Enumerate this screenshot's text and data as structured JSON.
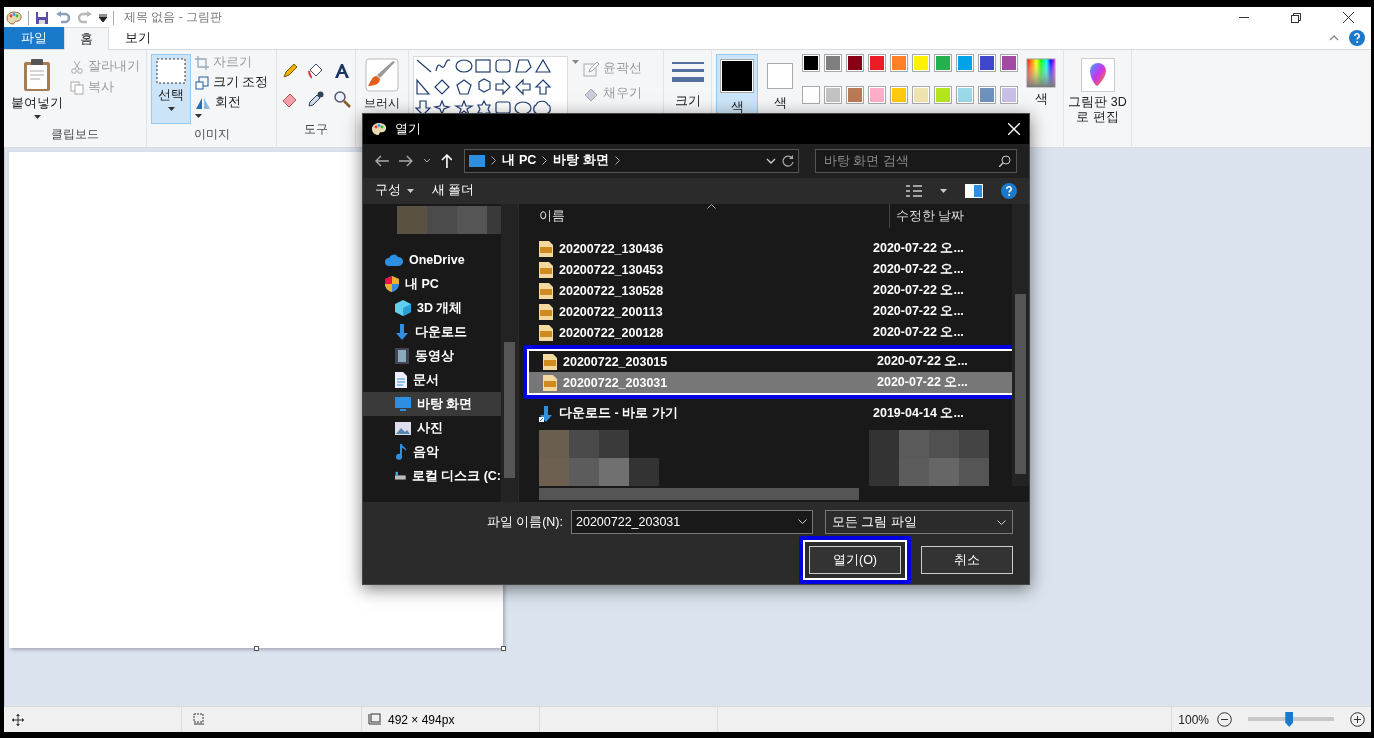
{
  "window": {
    "title": "제목 없음 - 그림판"
  },
  "tabs": [
    {
      "label": "파일",
      "selected": false,
      "kind": "file"
    },
    {
      "label": "홈",
      "selected": true,
      "kind": "tab"
    },
    {
      "label": "보기",
      "selected": false,
      "kind": "tab"
    }
  ],
  "ribbon": {
    "clipboard": {
      "label": "클립보드",
      "paste": "붙여넣기",
      "cut": {
        "label": "잘라내기",
        "disabled": true
      },
      "copy": {
        "label": "복사",
        "disabled": true
      }
    },
    "image": {
      "label": "이미지",
      "select": {
        "label": "선택",
        "selected": true
      },
      "crop": {
        "label": "자르기",
        "disabled": true
      },
      "resize": {
        "label": "크기 조정",
        "disabled": false
      },
      "rotate": {
        "label": "회전",
        "disabled": false
      }
    },
    "tools": {
      "label": "도구"
    },
    "brush": {
      "label": "브러시"
    },
    "shapes": {
      "outline": {
        "label": "윤곽선",
        "disabled": true
      },
      "fill": {
        "label": "채우기",
        "disabled": true
      }
    },
    "size": {
      "label": "크기"
    },
    "colors": {
      "slots": [
        {
          "label": "색",
          "color": "#000000",
          "selected": true
        },
        {
          "label": "색",
          "color": "#ffffff",
          "selected": false
        }
      ],
      "palette": [
        {
          "color": "#000000"
        },
        {
          "color": "#7f7f7f"
        },
        {
          "color": "#880015"
        },
        {
          "color": "#ed1c24"
        },
        {
          "color": "#ff7f27"
        },
        {
          "color": "#fff200"
        },
        {
          "color": "#22b14c"
        },
        {
          "color": "#00a2e8"
        },
        {
          "color": "#3f48cc"
        },
        {
          "color": "#a349a4"
        },
        {
          "color": "#ffffff"
        },
        {
          "color": "#c3c3c3"
        },
        {
          "color": "#b97a57"
        },
        {
          "color": "#ffaec9"
        },
        {
          "color": "#ffc90e"
        },
        {
          "color": "#efe4b0"
        },
        {
          "color": "#b5e61d"
        },
        {
          "color": "#99d9ea"
        },
        {
          "color": "#7092be"
        },
        {
          "color": "#c8bfe7"
        }
      ],
      "edit": "색"
    },
    "paint3d": {
      "label": "그림판 3D로 편집"
    }
  },
  "status_bar": {
    "dimensions": "492 × 494px",
    "zoom": "100%",
    "zoom_slider": {
      "level": 0.48
    }
  },
  "dialog": {
    "title": "열기",
    "address": [
      "내 PC",
      "바탕 화면"
    ],
    "search": {
      "placeholder": "바탕 화면 검색"
    },
    "toolbar": {
      "organize": "구성",
      "new_folder": "새 폴더"
    },
    "nav": [
      {
        "label": "OneDrive",
        "selected": false
      },
      {
        "label": "내 PC",
        "selected": false,
        "children": [
          {
            "label": "3D 개체",
            "selected": false
          },
          {
            "label": "다운로드",
            "selected": false
          },
          {
            "label": "동영상",
            "selected": false
          },
          {
            "label": "문서",
            "selected": false
          },
          {
            "label": "바탕 화면",
            "selected": true
          },
          {
            "label": "사진",
            "selected": false
          },
          {
            "label": "음악",
            "selected": false
          },
          {
            "label": "로컬 디스크 (C:",
            "selected": false
          }
        ]
      }
    ],
    "columns": [
      "이름",
      "수정한 날짜"
    ],
    "files": [
      {
        "name": "20200722_130436",
        "date": "2020-07-22 오...",
        "kind": "image",
        "selected": false,
        "highlighted": false
      },
      {
        "name": "20200722_130453",
        "date": "2020-07-22 오...",
        "kind": "image",
        "selected": false,
        "highlighted": false
      },
      {
        "name": "20200722_130528",
        "date": "2020-07-22 오...",
        "kind": "image",
        "selected": false,
        "highlighted": false
      },
      {
        "name": "20200722_200113",
        "date": "2020-07-22 오...",
        "kind": "image",
        "selected": false,
        "highlighted": false
      },
      {
        "name": "20200722_200128",
        "date": "2020-07-22 오...",
        "kind": "image",
        "selected": false,
        "highlighted": false
      },
      {
        "name": "20200722_203015",
        "date": "2020-07-22 오...",
        "kind": "image",
        "selected": false,
        "highlighted": true
      },
      {
        "name": "20200722_203031",
        "date": "2020-07-22 오...",
        "kind": "image",
        "selected": true,
        "highlighted": true
      },
      {
        "name": "다운로드 - 바로 가기",
        "date": "2019-04-14 오...",
        "kind": "shortcut",
        "selected": false,
        "highlighted": false
      }
    ],
    "file_name": {
      "label": "파일 이름(N):",
      "value": "20200722_203031"
    },
    "filter": "모든 그림 파일",
    "buttons": [
      {
        "label": "열기(O)",
        "highlighted": true
      },
      {
        "label": "취소",
        "highlighted": false
      }
    ]
  }
}
